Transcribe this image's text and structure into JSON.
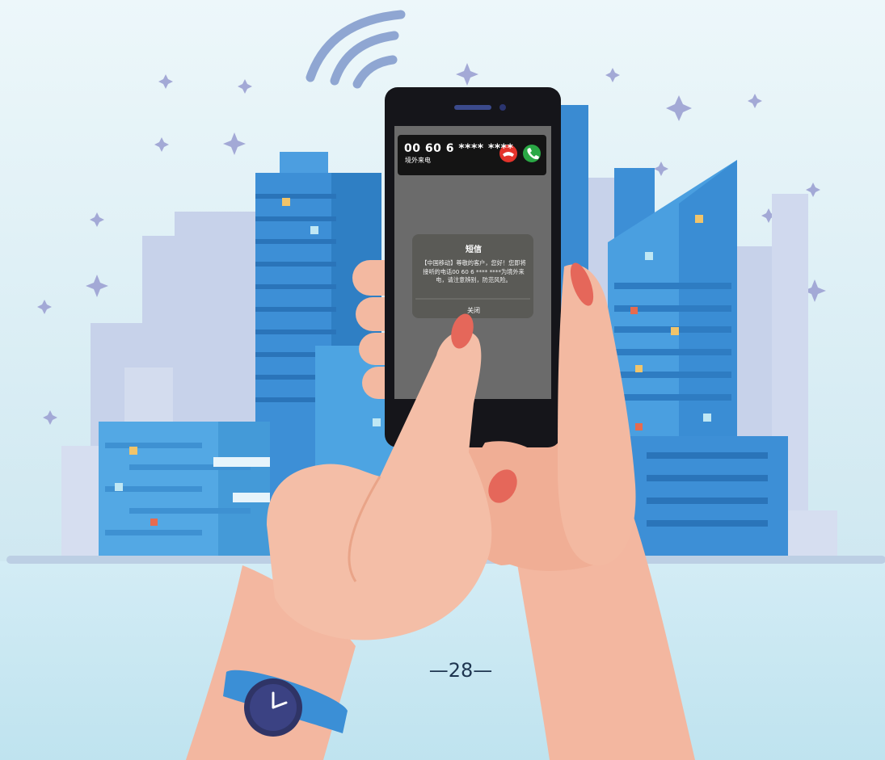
{
  "incoming_call": {
    "number": "00 60 6 **** ****",
    "type_label": "境外来电",
    "decline_icon": "phone-hangup-icon",
    "accept_icon": "phone-answer-icon",
    "decline_color": "#e3332b",
    "accept_color": "#2aa845"
  },
  "sms_popup": {
    "title": "短信",
    "body": "【中国移动】尊敬的客户，您好！您即将接听的电话00 60 6 **** ****为境外来电，请注意辨别，防范风险。",
    "close_label": "关闭"
  },
  "page": {
    "number": "—28—"
  },
  "colors": {
    "sky": "#dbeef4",
    "building_blue": "#3d8fd6",
    "building_pale": "#c9d4ea",
    "skin": "#f3b9a1",
    "nail": "#e5675a",
    "watch_band": "#3b8fd6",
    "watch_face": "#2f3466"
  }
}
